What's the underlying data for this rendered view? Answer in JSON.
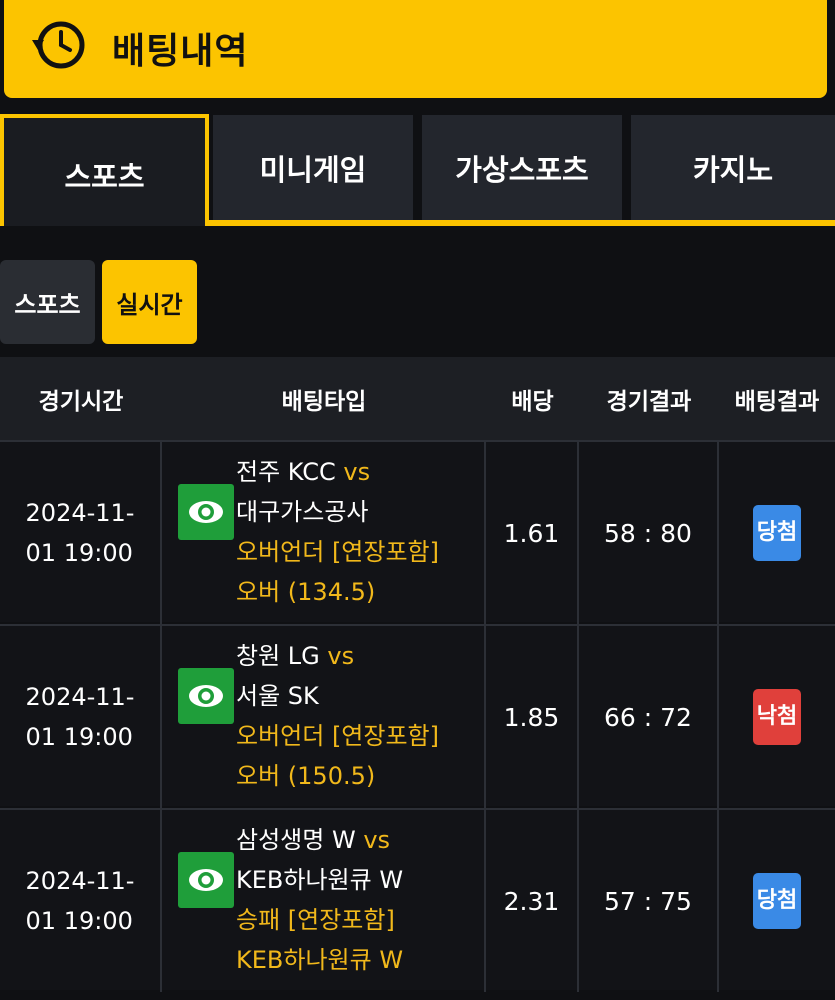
{
  "header": {
    "title": "배팅내역",
    "icon": "history-clock-icon"
  },
  "tabs": [
    {
      "label": "스포츠",
      "active": true
    },
    {
      "label": "미니게임",
      "active": false
    },
    {
      "label": "가상스포츠",
      "active": false
    },
    {
      "label": "카지노",
      "active": false
    }
  ],
  "subtabs": [
    {
      "label": "스포츠",
      "active": false
    },
    {
      "label": "실시간",
      "active": true
    }
  ],
  "table": {
    "headers": [
      "경기시간",
      "배팅타입",
      "배당",
      "경기결과",
      "배팅결과"
    ],
    "rows": [
      {
        "time": "2024-11-\n01 19:00",
        "home": "전주 KCC",
        "vs": "vs",
        "away": "대구가스공사",
        "market": "오버언더 [연장포함]",
        "pick": "오버 (134.5)",
        "odds": "1.61",
        "score": "58 : 80",
        "result": "당첨",
        "result_status": "win"
      },
      {
        "time": "2024-11-\n01 19:00",
        "home": "창원 LG",
        "vs": "vs",
        "away": "서울 SK",
        "market": "오버언더 [연장포함]",
        "pick": "오버 (150.5)",
        "odds": "1.85",
        "score": "66 : 72",
        "result": "낙첨",
        "result_status": "lose"
      },
      {
        "time": "2024-11-\n01 19:00",
        "home": "삼성생명 W",
        "vs": "vs",
        "away": "KEB하나원큐 W",
        "market": "승패 [연장포함]",
        "pick": "KEB하나원큐 W",
        "odds": "2.31",
        "score": "57 : 75",
        "result": "당첨",
        "result_status": "win"
      }
    ]
  },
  "colors": {
    "accent": "#fcc400",
    "win": "#3a8ae6",
    "lose": "#e0403b",
    "eye": "#1f9e3a"
  }
}
